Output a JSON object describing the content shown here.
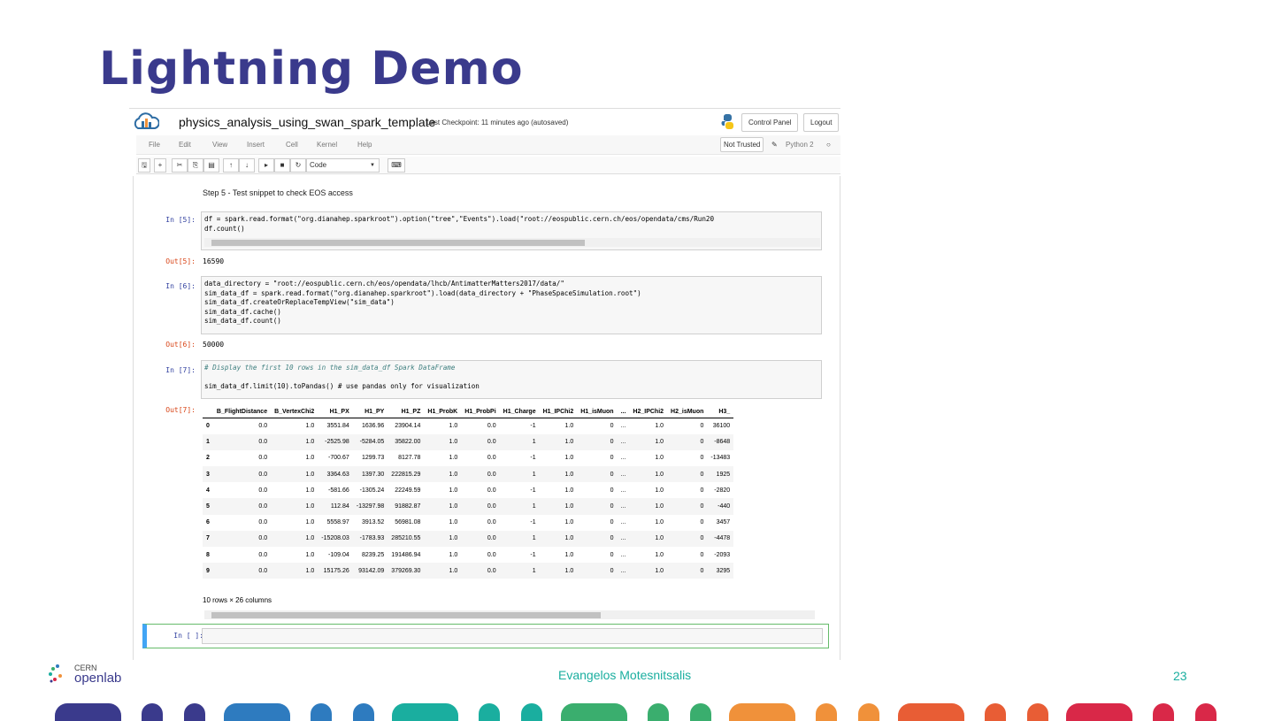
{
  "slide": {
    "title": "Lightning Demo",
    "author": "Evangelos Motesnitsalis",
    "page": "23",
    "logo_text": [
      "CERN",
      "openlab"
    ]
  },
  "notebook": {
    "name": "physics_analysis_using_swan_spark_template",
    "checkpoint": "Last Checkpoint: 11 minutes ago (autosaved)",
    "control_panel": "Control Panel",
    "logout": "Logout",
    "menu": [
      "File",
      "Edit",
      "View",
      "Insert",
      "Cell",
      "Kernel",
      "Help"
    ],
    "not_trusted": "Not Trusted",
    "kernel": "Python 2",
    "cell_type": "Code",
    "markdown": "Step 5 - Test snippet to check EOS access",
    "cells": [
      {
        "in": "In [5]:",
        "out": "Out[5]:",
        "result": "16590"
      },
      {
        "in": "In [6]:",
        "out": "Out[6]:",
        "result": "50000"
      },
      {
        "in": "In [7]:",
        "out": "Out[7]:"
      },
      {
        "in": "In [ ]:"
      }
    ],
    "code5": [
      "df = spark.read.format(\"org.dianahep.sparkroot\").option(\"tree\",\"Events\").load(\"root://eospublic.cern.ch/eos/opendata/cms/Run20",
      "df.count()"
    ],
    "code6": [
      "data_directory = \"root://eospublic.cern.ch/eos/opendata/lhcb/AntimatterMatters2017/data/\"",
      "sim_data_df = spark.read.format(\"org.dianahep.sparkroot\").load(data_directory + \"PhaseSpaceSimulation.root\")",
      "sim_data_df.createOrReplaceTempView(\"sim_data\")",
      "sim_data_df.cache()",
      "sim_data_df.count()"
    ],
    "code7": [
      "# Display the first 10 rows in the sim_data_df Spark DataFrame",
      "",
      "sim_data_df.limit(10).toPandas() # use pandas only for visualization"
    ],
    "table": {
      "columns": [
        "",
        "B_FlightDistance",
        "B_VertexChi2",
        "H1_PX",
        "H1_PY",
        "H1_PZ",
        "H1_ProbK",
        "H1_ProbPi",
        "H1_Charge",
        "H1_IPChi2",
        "H1_isMuon",
        "...",
        "H2_IPChi2",
        "H2_isMuon",
        "H3_"
      ],
      "rows": [
        [
          "0",
          "0.0",
          "1.0",
          "3551.84",
          "1636.96",
          "23904.14",
          "1.0",
          "0.0",
          "-1",
          "1.0",
          "0",
          "...",
          "1.0",
          "0",
          "36100"
        ],
        [
          "1",
          "0.0",
          "1.0",
          "-2525.98",
          "-5284.05",
          "35822.00",
          "1.0",
          "0.0",
          "1",
          "1.0",
          "0",
          "...",
          "1.0",
          "0",
          "-8648"
        ],
        [
          "2",
          "0.0",
          "1.0",
          "-700.67",
          "1299.73",
          "8127.78",
          "1.0",
          "0.0",
          "-1",
          "1.0",
          "0",
          "...",
          "1.0",
          "0",
          "-13483"
        ],
        [
          "3",
          "0.0",
          "1.0",
          "3364.63",
          "1397.30",
          "222815.29",
          "1.0",
          "0.0",
          "1",
          "1.0",
          "0",
          "...",
          "1.0",
          "0",
          "1925"
        ],
        [
          "4",
          "0.0",
          "1.0",
          "-581.66",
          "-1305.24",
          "22249.59",
          "1.0",
          "0.0",
          "-1",
          "1.0",
          "0",
          "...",
          "1.0",
          "0",
          "-2820"
        ],
        [
          "5",
          "0.0",
          "1.0",
          "112.84",
          "-13297.98",
          "91882.87",
          "1.0",
          "0.0",
          "1",
          "1.0",
          "0",
          "...",
          "1.0",
          "0",
          "-440"
        ],
        [
          "6",
          "0.0",
          "1.0",
          "5558.97",
          "3913.52",
          "56981.08",
          "1.0",
          "0.0",
          "-1",
          "1.0",
          "0",
          "...",
          "1.0",
          "0",
          "3457"
        ],
        [
          "7",
          "0.0",
          "1.0",
          "-15208.03",
          "-1783.93",
          "285210.55",
          "1.0",
          "0.0",
          "1",
          "1.0",
          "0",
          "...",
          "1.0",
          "0",
          "-4478"
        ],
        [
          "8",
          "0.0",
          "1.0",
          "-109.04",
          "8239.25",
          "191486.94",
          "1.0",
          "0.0",
          "-1",
          "1.0",
          "0",
          "...",
          "1.0",
          "0",
          "-2093"
        ],
        [
          "9",
          "0.0",
          "1.0",
          "15175.26",
          "93142.09",
          "379269.30",
          "1.0",
          "0.0",
          "1",
          "1.0",
          "0",
          "...",
          "1.0",
          "0",
          "3295"
        ]
      ],
      "summary": "10 rows × 26 columns"
    }
  },
  "colors": {
    "title": "#3a3a8c",
    "footer": "#1aae9f",
    "bands": [
      "#3a3a8c",
      "#2e7bbf",
      "#1aae9f",
      "#3aae6e",
      "#f0913a",
      "#e85d35",
      "#d92848"
    ]
  }
}
